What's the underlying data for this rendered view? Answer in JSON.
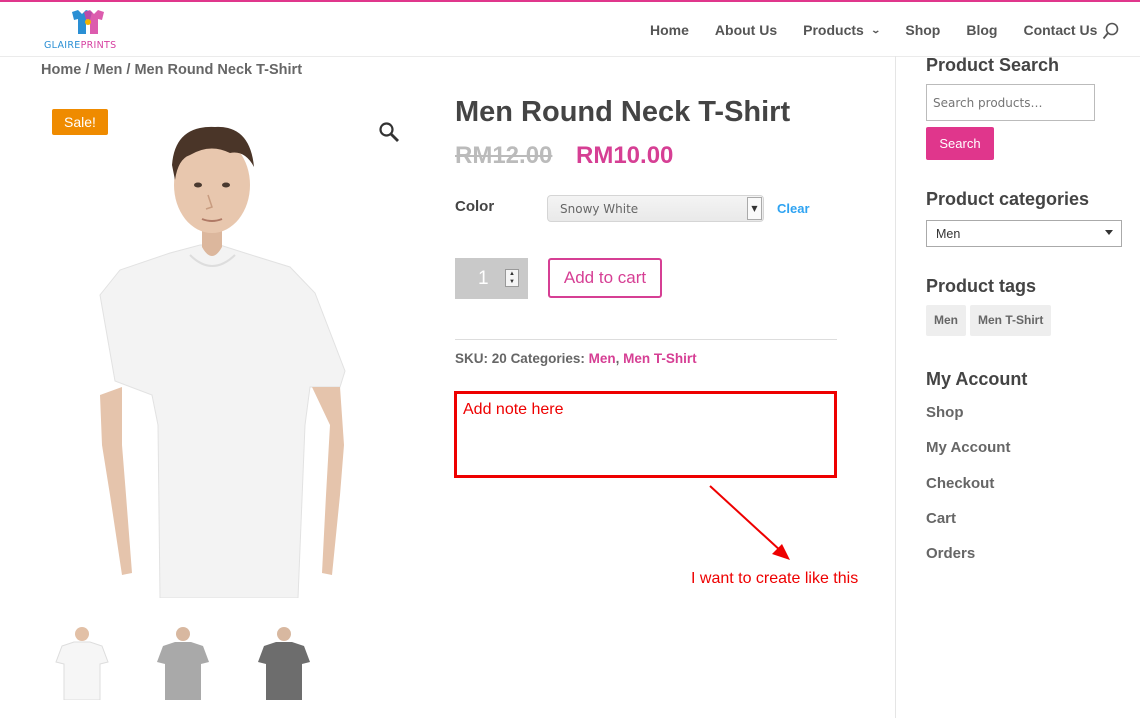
{
  "brand": {
    "logo_text_a": "GLAIRE",
    "logo_text_b": "PRINTS",
    "accent": "#e0368c",
    "price_color": "#d63f94",
    "sale_color": "#ef8b00",
    "link_color": "#2ea3f2",
    "annotation_color": "#e00000"
  },
  "nav": {
    "items": [
      {
        "label": "Home"
      },
      {
        "label": "About Us"
      },
      {
        "label": "Products"
      },
      {
        "label": "Shop"
      },
      {
        "label": "Blog"
      },
      {
        "label": "Contact Us"
      }
    ],
    "products_chevron": "chevron-down-icon",
    "search_icon": "search-icon"
  },
  "breadcrumb": "Home / Men / Men Round Neck T-Shirt",
  "gallery": {
    "sale_badge": "Sale!",
    "zoom_icon": "magnifier-icon",
    "thumbnails": [
      "white t-shirt",
      "grey t-shirt",
      "dark grey t-shirt"
    ]
  },
  "product": {
    "title": "Men Round Neck T-Shirt",
    "price_old": "RM12.00",
    "price_new": "RM10.00",
    "color_label": "Color",
    "color_selected": "Snowy White",
    "clear_label": "Clear",
    "quantity": "1",
    "add_to_cart": "Add to cart",
    "sku_label": "SKU:",
    "sku_value": "20",
    "categories_label": "Categories:",
    "category_1": "Men",
    "category_sep": ",",
    "category_2": "Men T-Shirt"
  },
  "annotation": {
    "note_placeholder": "Add note here",
    "caption": "I want to create like this"
  },
  "sidebar": {
    "search_heading": "Product Search",
    "search_placeholder": "Search products…",
    "search_button": "Search",
    "categories_heading": "Product categories",
    "categories_selected": "Men",
    "tags_heading": "Product tags",
    "tags": [
      "Men",
      "Men T-Shirt"
    ],
    "account_heading": "My Account",
    "account_links": [
      "Shop",
      "My Account",
      "Checkout",
      "Cart",
      "Orders"
    ]
  }
}
